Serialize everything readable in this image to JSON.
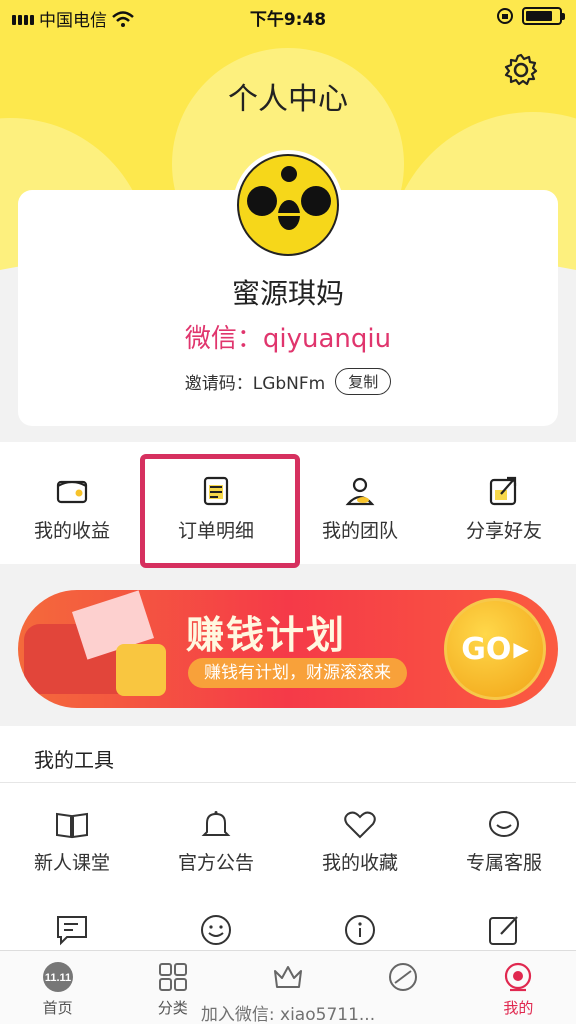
{
  "status_bar": {
    "carrier": "中国电信",
    "time": "下午9:48"
  },
  "header": {
    "title": "个人中心"
  },
  "profile": {
    "name": "蜜源琪妈",
    "wechat": "微信：qiyuanqiu",
    "invite_label": "邀请码：LGbNFm",
    "copy_label": "复制"
  },
  "menu": {
    "items": [
      {
        "label": "我的收益",
        "icon": "wallet-icon"
      },
      {
        "label": "订单明细",
        "icon": "order-list-icon"
      },
      {
        "label": "我的团队",
        "icon": "team-icon"
      },
      {
        "label": "分享好友",
        "icon": "share-icon"
      }
    ]
  },
  "banner": {
    "title": "赚钱计划",
    "subtitle": "赚钱有计划，财源滚滚来",
    "go_label": "GO"
  },
  "tools": {
    "title": "我的工具",
    "items": [
      {
        "label": "新人课堂",
        "icon": "book-icon"
      },
      {
        "label": "官方公告",
        "icon": "bell-icon"
      },
      {
        "label": "我的收藏",
        "icon": "heart-icon"
      },
      {
        "label": "专属客服",
        "icon": "chat-icon"
      }
    ],
    "row2_icons": [
      "message-icon",
      "smile-icon",
      "info-icon",
      "edit-icon"
    ]
  },
  "tabbar": {
    "items": [
      {
        "label": "首页",
        "icon": "home-1111-icon"
      },
      {
        "label": "分类",
        "icon": "category-grid-icon"
      },
      {
        "label": "",
        "icon": "crown-icon"
      },
      {
        "label": "",
        "icon": "circle-icon"
      },
      {
        "label": "我的",
        "icon": "profile-icon"
      }
    ],
    "home_badge": "11.11"
  },
  "watermark": "加入微信: xiao5711..."
}
